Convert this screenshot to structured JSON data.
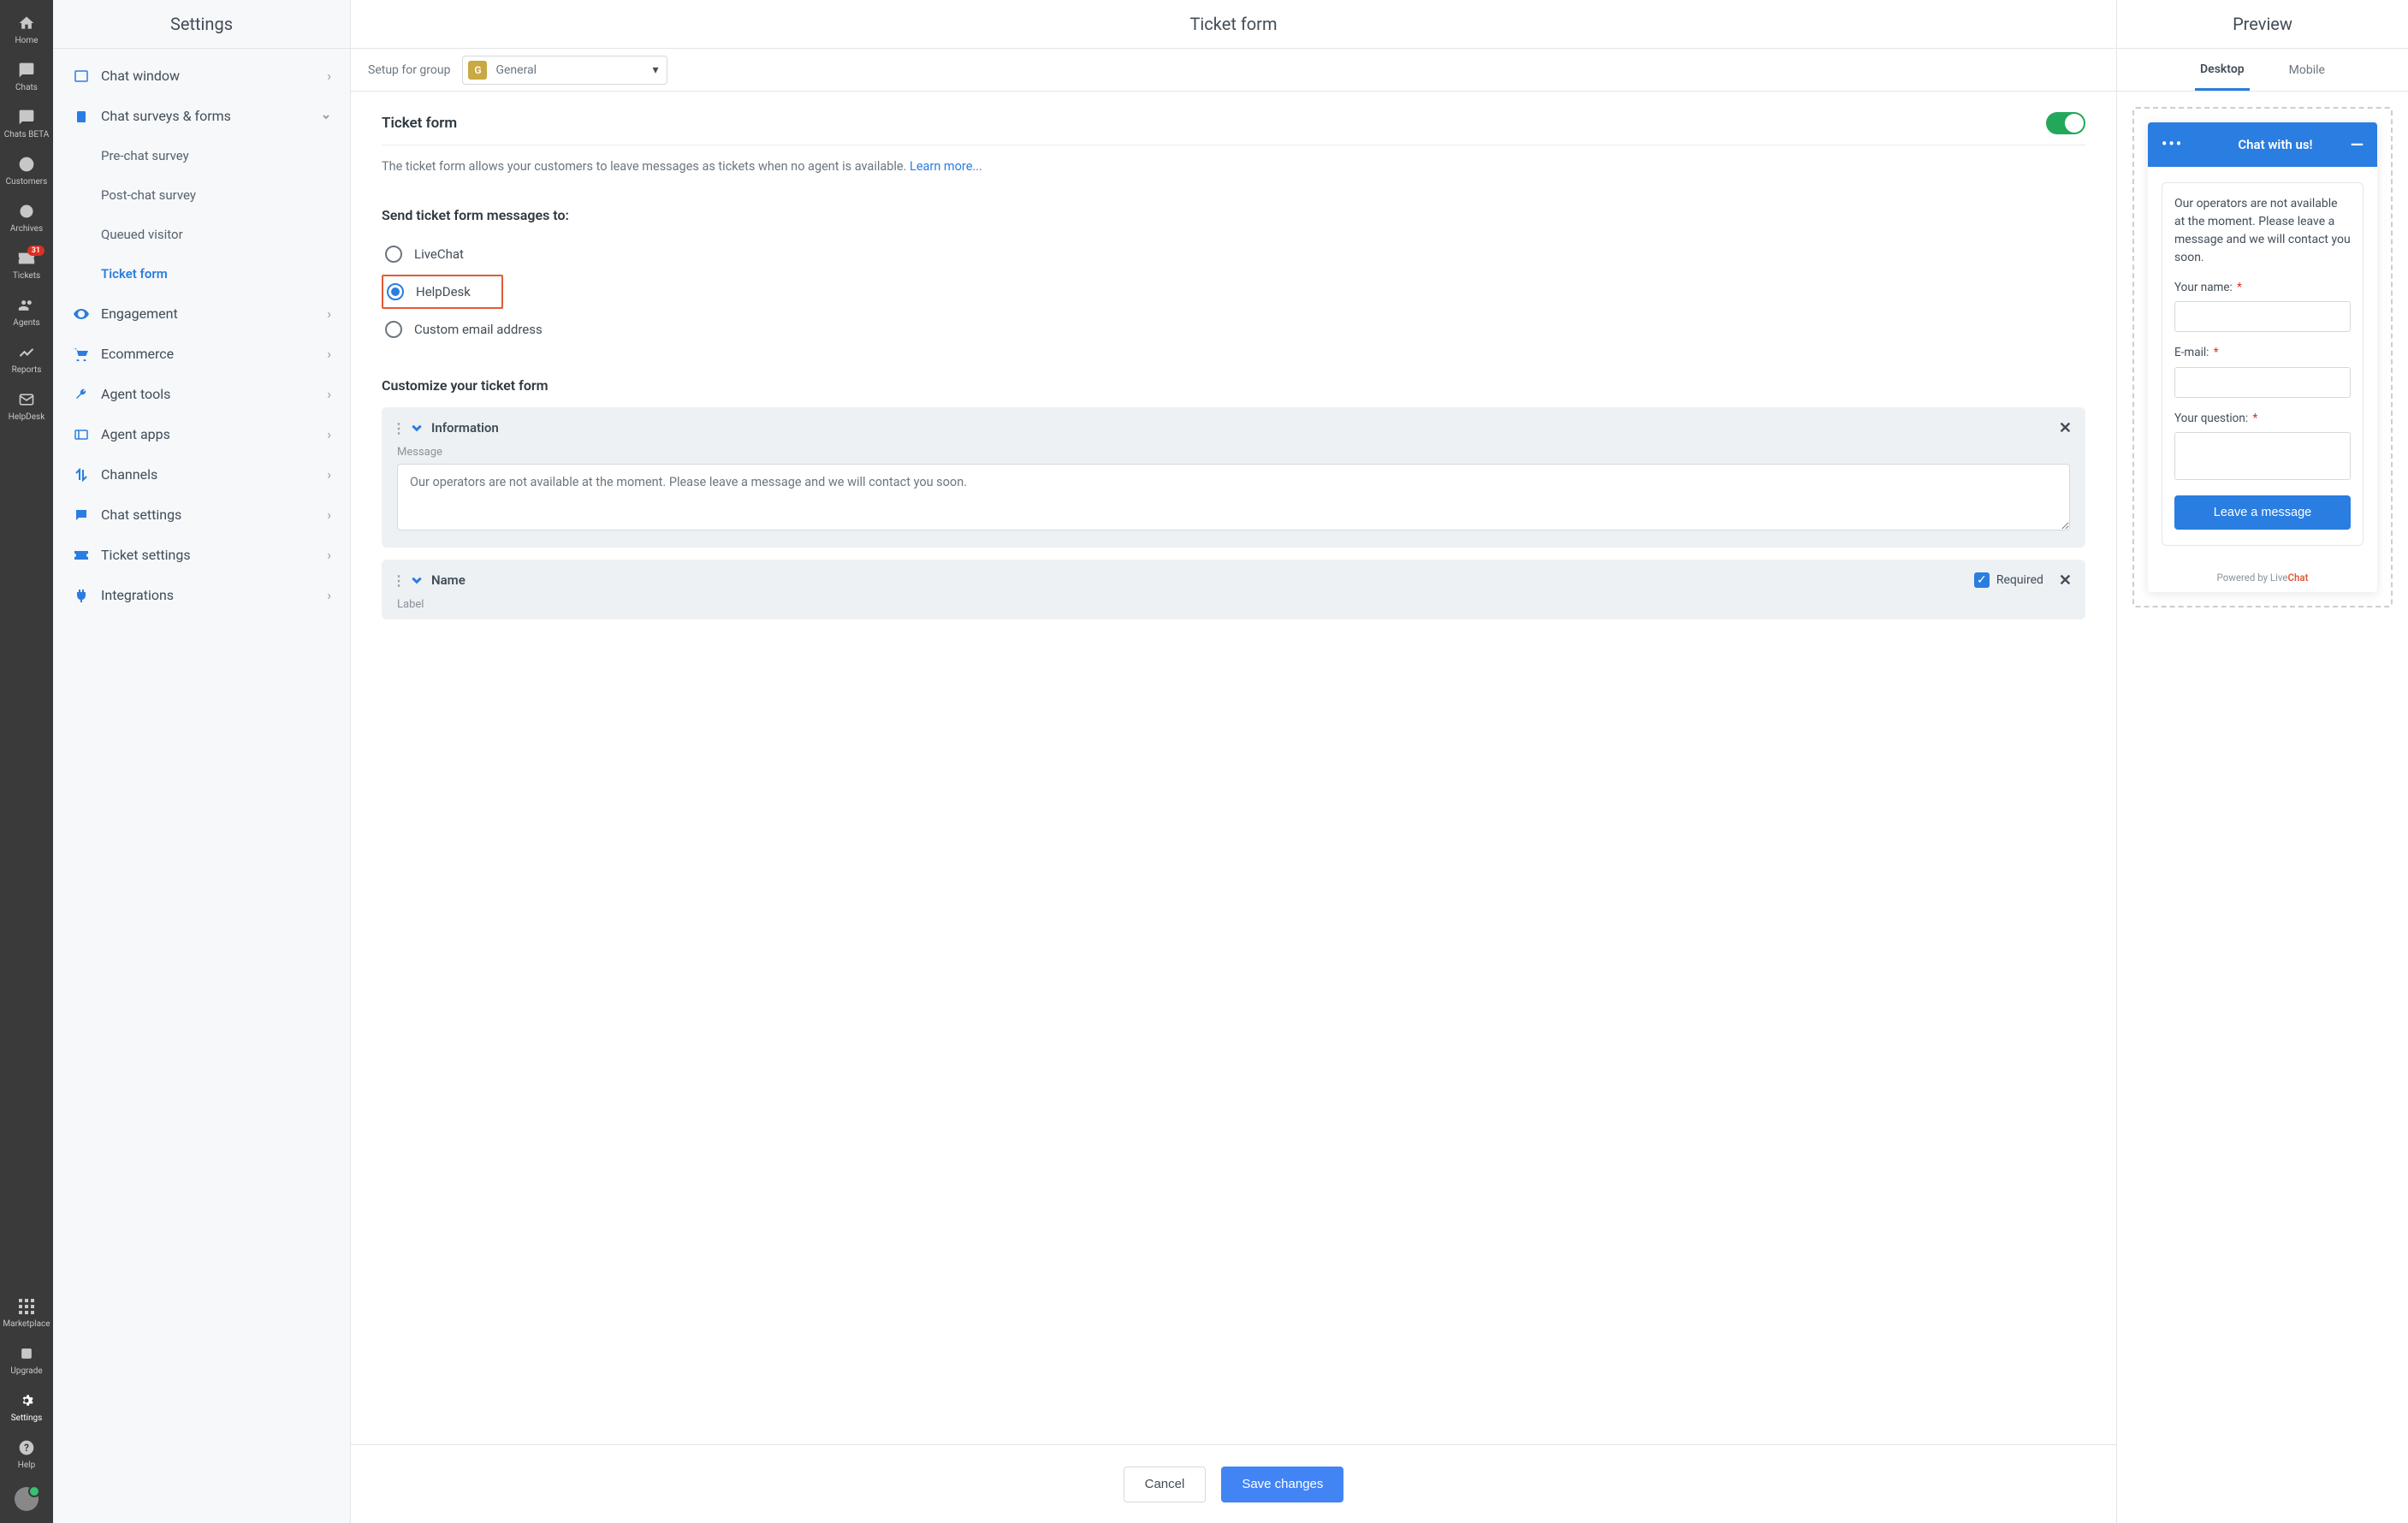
{
  "rail": {
    "home": "Home",
    "chats": "Chats",
    "chats_beta": "Chats BETA",
    "customers": "Customers",
    "archives": "Archives",
    "tickets": "Tickets",
    "tickets_badge": "31",
    "agents": "Agents",
    "reports": "Reports",
    "helpdesk": "HelpDesk",
    "marketplace": "Marketplace",
    "upgrade": "Upgrade",
    "settings": "Settings",
    "help": "Help"
  },
  "sidebar": {
    "title": "Settings",
    "items": {
      "chat_window": "Chat window",
      "chat_surveys": "Chat surveys & forms",
      "pre_chat": "Pre-chat survey",
      "post_chat": "Post-chat survey",
      "queued": "Queued visitor",
      "ticket_form": "Ticket form",
      "engagement": "Engagement",
      "ecommerce": "Ecommerce",
      "agent_tools": "Agent tools",
      "agent_apps": "Agent apps",
      "channels": "Channels",
      "chat_settings": "Chat settings",
      "ticket_settings": "Ticket settings",
      "integrations": "Integrations"
    }
  },
  "main": {
    "title": "Ticket form",
    "setup_label": "Setup for group",
    "group_badge": "G",
    "group_name": "General",
    "section_title": "Ticket form",
    "section_desc": "The ticket form allows your customers to leave messages as tickets when no agent is available. ",
    "learn_more": "Learn more...",
    "send_to_title": "Send ticket form messages to:",
    "radio_livechat": "LiveChat",
    "radio_helpdesk": "HelpDesk",
    "radio_custom": "Custom email address",
    "customize_title": "Customize your ticket form",
    "card_info_title": "Information",
    "card_info_label": "Message",
    "card_info_value": "Our operators are not available at the moment. Please leave a message and we will contact you soon.",
    "card_name_title": "Name",
    "card_name_required": "Required",
    "card_name_label": "Label",
    "cancel": "Cancel",
    "save": "Save changes"
  },
  "preview": {
    "title": "Preview",
    "tab_desktop": "Desktop",
    "tab_mobile": "Mobile",
    "chat_title": "Chat with us!",
    "msg": "Our operators are not available at the moment. Please leave a message and we will contact you soon.",
    "name_label": "Your name:",
    "email_label": "E-mail:",
    "question_label": "Your question:",
    "leave_btn": "Leave a message",
    "powered_pre": "Powered by Live",
    "powered_brand": "Chat"
  }
}
